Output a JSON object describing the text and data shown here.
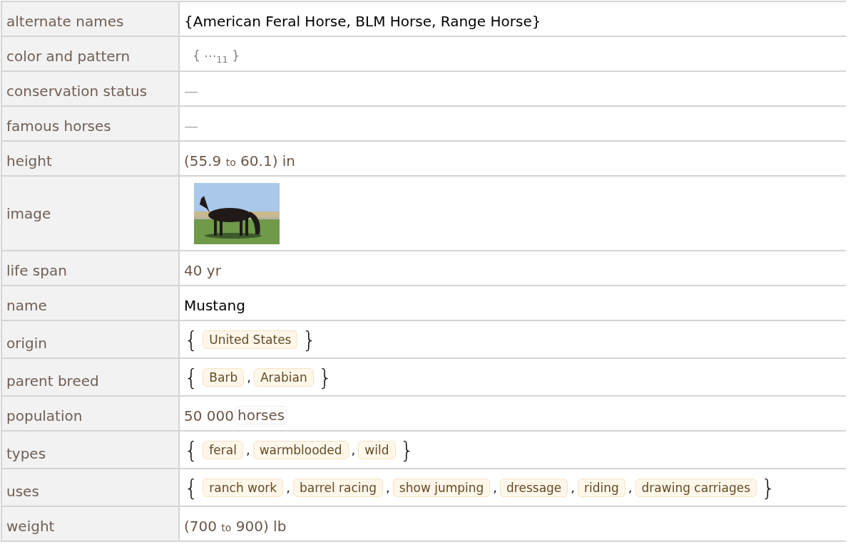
{
  "rows": [
    {
      "label": "alternate names",
      "kind": "text",
      "value": "{American Feral Horse, BLM Horse, Range Horse}"
    },
    {
      "label": "color and pattern",
      "kind": "elided",
      "open": "{",
      "ellipsis": "⋯",
      "count": "11",
      "close": "}"
    },
    {
      "label": "conservation status",
      "kind": "missing",
      "value": "—"
    },
    {
      "label": "famous horses",
      "kind": "missing",
      "value": "—"
    },
    {
      "label": "height",
      "kind": "range",
      "low": "(55.9",
      "word": "to",
      "high": "60.1)",
      "unit": "in"
    },
    {
      "label": "image",
      "kind": "picture"
    },
    {
      "label": "life span",
      "kind": "quantity",
      "value": "40 yr"
    },
    {
      "label": "name",
      "kind": "text",
      "value": "Mustang"
    },
    {
      "label": "origin",
      "kind": "entities",
      "open": "{",
      "close": "}",
      "items": [
        "United States"
      ]
    },
    {
      "label": "parent breed",
      "kind": "entities",
      "open": "{",
      "close": "}",
      "separator": ",",
      "items": [
        "Barb",
        "Arabian"
      ]
    },
    {
      "label": "population",
      "kind": "boxed",
      "value": "50 000",
      "unit": "horses"
    },
    {
      "label": "types",
      "kind": "entities",
      "open": "{",
      "close": "}",
      "separator": ",",
      "items": [
        "feral",
        "warmblooded",
        "wild"
      ]
    },
    {
      "label": "uses",
      "kind": "entities",
      "open": "{",
      "close": "}",
      "separator": ",",
      "items": [
        "ranch work",
        "barrel racing",
        "show jumping",
        "dressage",
        "riding",
        "drawing carriages"
      ]
    },
    {
      "label": "weight",
      "kind": "range",
      "low": "(700",
      "word": "to",
      "high": "900)",
      "unit": "lb"
    }
  ]
}
